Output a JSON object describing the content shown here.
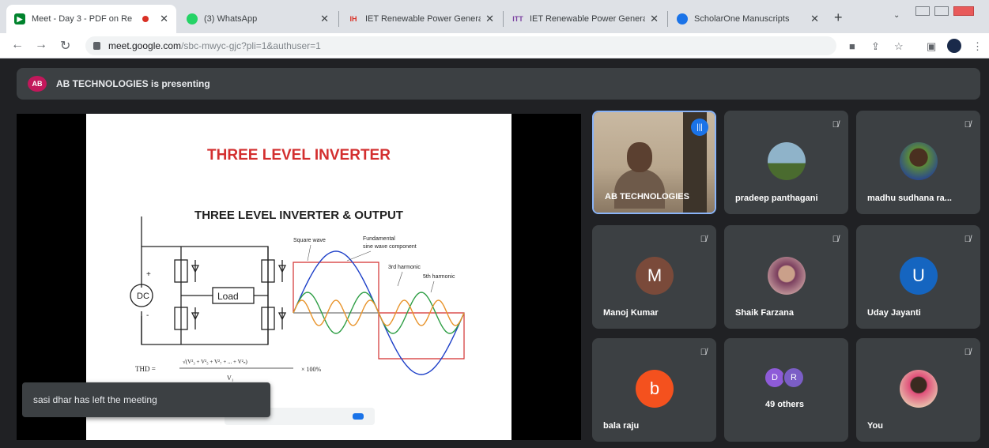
{
  "browser": {
    "tabs": [
      {
        "title": "Meet - Day 3 - PDF on Re",
        "favicon": "meet-icon",
        "color": "#00832d",
        "active": true,
        "recording": true
      },
      {
        "title": "(3) WhatsApp",
        "favicon": "whatsapp-icon",
        "color": "#25d366"
      },
      {
        "title": "IET Renewable Power Generati",
        "favicon": "journal-icon",
        "color": "#d93025"
      },
      {
        "title": "IET Renewable Power Generati",
        "favicon": "journal-icon",
        "color": "#7b3fa0"
      },
      {
        "title": "ScholarOne Manuscripts",
        "favicon": "scholarone-icon",
        "color": "#1a73e8"
      }
    ],
    "url_host": "meet.google.com",
    "url_rest": "/sbc-mwyc-gjc?pli=1&authuser=1"
  },
  "meet": {
    "presenting_label": "AB TECHNOLOGIES is presenting",
    "presenter_logo": "AB",
    "slide": {
      "title": "THREE LEVEL INVERTER",
      "subtitle": "THREE LEVEL INVERTER & OUTPUT",
      "dc_label": "DC",
      "load_label": "Load",
      "plus": "+",
      "minus": "-",
      "wave_labels": {
        "square": "Square wave",
        "fundamental_1": "Fundamental",
        "fundamental_2": "sine wave component",
        "third": "3rd harmonic",
        "fifth": "5th harmonic"
      },
      "thd_prefix": "THD =",
      "thd_num": "√(V²₃ + V²₅ + V²₇ + ... + V²ₙ)",
      "thd_den": "V₁",
      "thd_suffix": "× 100%"
    },
    "toast": "sasi dhar has left the meeting",
    "participants": [
      {
        "name": "AB TECHNOLOGIES",
        "type": "camera",
        "speaking": true
      },
      {
        "name": "pradeep panthagani",
        "type": "photo",
        "photo_colors": [
          "#8fb3c9",
          "#4a6b2f"
        ]
      },
      {
        "name": "madhu sudhana ra...",
        "type": "photo",
        "photo_colors": [
          "#5b8a3a",
          "#2c4a8a"
        ]
      },
      {
        "name": "Manoj Kumar",
        "type": "initial",
        "initial": "M",
        "color": "#7a4a3a"
      },
      {
        "name": "Shaik Farzana",
        "type": "photo",
        "photo_colors": [
          "#c9a0a0",
          "#7a3e5e"
        ]
      },
      {
        "name": "Uday Jayanti",
        "type": "initial",
        "initial": "U",
        "color": "#1565c0"
      },
      {
        "name": "bala raju",
        "type": "initial",
        "initial": "b",
        "color": "#f4511e"
      },
      {
        "name": "49 others",
        "type": "others",
        "initials": [
          "D",
          "R"
        ],
        "colors": [
          "#8e5bd8",
          "#7b5ec6"
        ]
      },
      {
        "name": "You",
        "type": "photo",
        "photo_colors": [
          "#e8c9b0",
          "#e0507a"
        ]
      }
    ]
  }
}
